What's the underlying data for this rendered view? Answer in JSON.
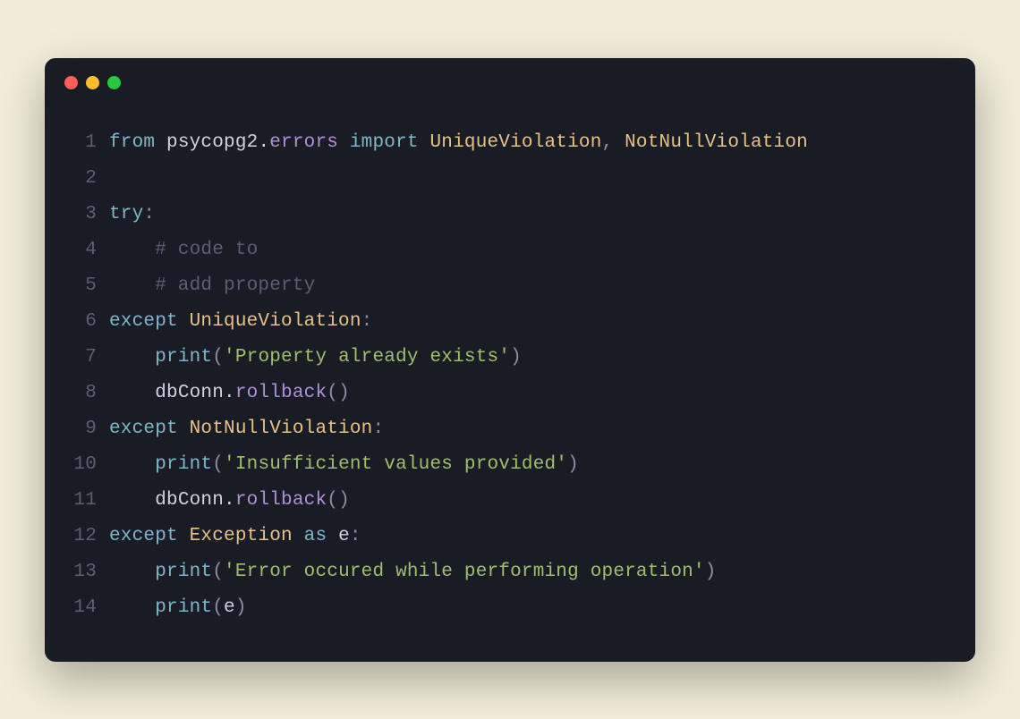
{
  "window": {
    "traffic_lights": [
      "close",
      "minimize",
      "maximize"
    ]
  },
  "code": {
    "lines": [
      {
        "n": "1",
        "tokens": [
          {
            "t": "from ",
            "c": "tk-kw"
          },
          {
            "t": "psycopg2",
            "c": "tk-mod"
          },
          {
            "t": ".",
            "c": "tk-dot"
          },
          {
            "t": "errors",
            "c": "tk-sub"
          },
          {
            "t": " import ",
            "c": "tk-kw"
          },
          {
            "t": "UniqueViolation",
            "c": "tk-class"
          },
          {
            "t": ", ",
            "c": "tk-punct"
          },
          {
            "t": "NotNullViolation",
            "c": "tk-class"
          }
        ]
      },
      {
        "n": "2",
        "tokens": []
      },
      {
        "n": "3",
        "tokens": [
          {
            "t": "try",
            "c": "tk-kw"
          },
          {
            "t": ":",
            "c": "tk-punct"
          }
        ]
      },
      {
        "n": "4",
        "tokens": [
          {
            "t": "    # code to",
            "c": "tk-comment"
          }
        ]
      },
      {
        "n": "5",
        "tokens": [
          {
            "t": "    # add property",
            "c": "tk-comment"
          }
        ]
      },
      {
        "n": "6",
        "tokens": [
          {
            "t": "except ",
            "c": "tk-kw"
          },
          {
            "t": "UniqueViolation",
            "c": "tk-class"
          },
          {
            "t": ":",
            "c": "tk-punct"
          }
        ]
      },
      {
        "n": "7",
        "tokens": [
          {
            "t": "    ",
            "c": ""
          },
          {
            "t": "print",
            "c": "tk-func"
          },
          {
            "t": "(",
            "c": "tk-punct"
          },
          {
            "t": "'Property already exists'",
            "c": "tk-str"
          },
          {
            "t": ")",
            "c": "tk-punct"
          }
        ]
      },
      {
        "n": "8",
        "tokens": [
          {
            "t": "    ",
            "c": ""
          },
          {
            "t": "dbConn",
            "c": "tk-var"
          },
          {
            "t": ".",
            "c": "tk-dot"
          },
          {
            "t": "rollback",
            "c": "tk-attr"
          },
          {
            "t": "()",
            "c": "tk-punct"
          }
        ]
      },
      {
        "n": "9",
        "tokens": [
          {
            "t": "except ",
            "c": "tk-kw"
          },
          {
            "t": "NotNullViolation",
            "c": "tk-class"
          },
          {
            "t": ":",
            "c": "tk-punct"
          }
        ]
      },
      {
        "n": "10",
        "tokens": [
          {
            "t": "    ",
            "c": ""
          },
          {
            "t": "print",
            "c": "tk-func"
          },
          {
            "t": "(",
            "c": "tk-punct"
          },
          {
            "t": "'Insufficient values provided'",
            "c": "tk-str"
          },
          {
            "t": ")",
            "c": "tk-punct"
          }
        ]
      },
      {
        "n": "11",
        "tokens": [
          {
            "t": "    ",
            "c": ""
          },
          {
            "t": "dbConn",
            "c": "tk-var"
          },
          {
            "t": ".",
            "c": "tk-dot"
          },
          {
            "t": "rollback",
            "c": "tk-attr"
          },
          {
            "t": "()",
            "c": "tk-punct"
          }
        ]
      },
      {
        "n": "12",
        "tokens": [
          {
            "t": "except ",
            "c": "tk-kw"
          },
          {
            "t": "Exception",
            "c": "tk-class"
          },
          {
            "t": " as ",
            "c": "tk-kw"
          },
          {
            "t": "e",
            "c": "tk-var"
          },
          {
            "t": ":",
            "c": "tk-punct"
          }
        ]
      },
      {
        "n": "13",
        "tokens": [
          {
            "t": "    ",
            "c": ""
          },
          {
            "t": "print",
            "c": "tk-func"
          },
          {
            "t": "(",
            "c": "tk-punct"
          },
          {
            "t": "'Error occured while performing operation'",
            "c": "tk-str"
          },
          {
            "t": ")",
            "c": "tk-punct"
          }
        ]
      },
      {
        "n": "14",
        "tokens": [
          {
            "t": "    ",
            "c": ""
          },
          {
            "t": "print",
            "c": "tk-func"
          },
          {
            "t": "(",
            "c": "tk-punct"
          },
          {
            "t": "e",
            "c": "tk-var"
          },
          {
            "t": ")",
            "c": "tk-punct"
          }
        ]
      }
    ]
  }
}
